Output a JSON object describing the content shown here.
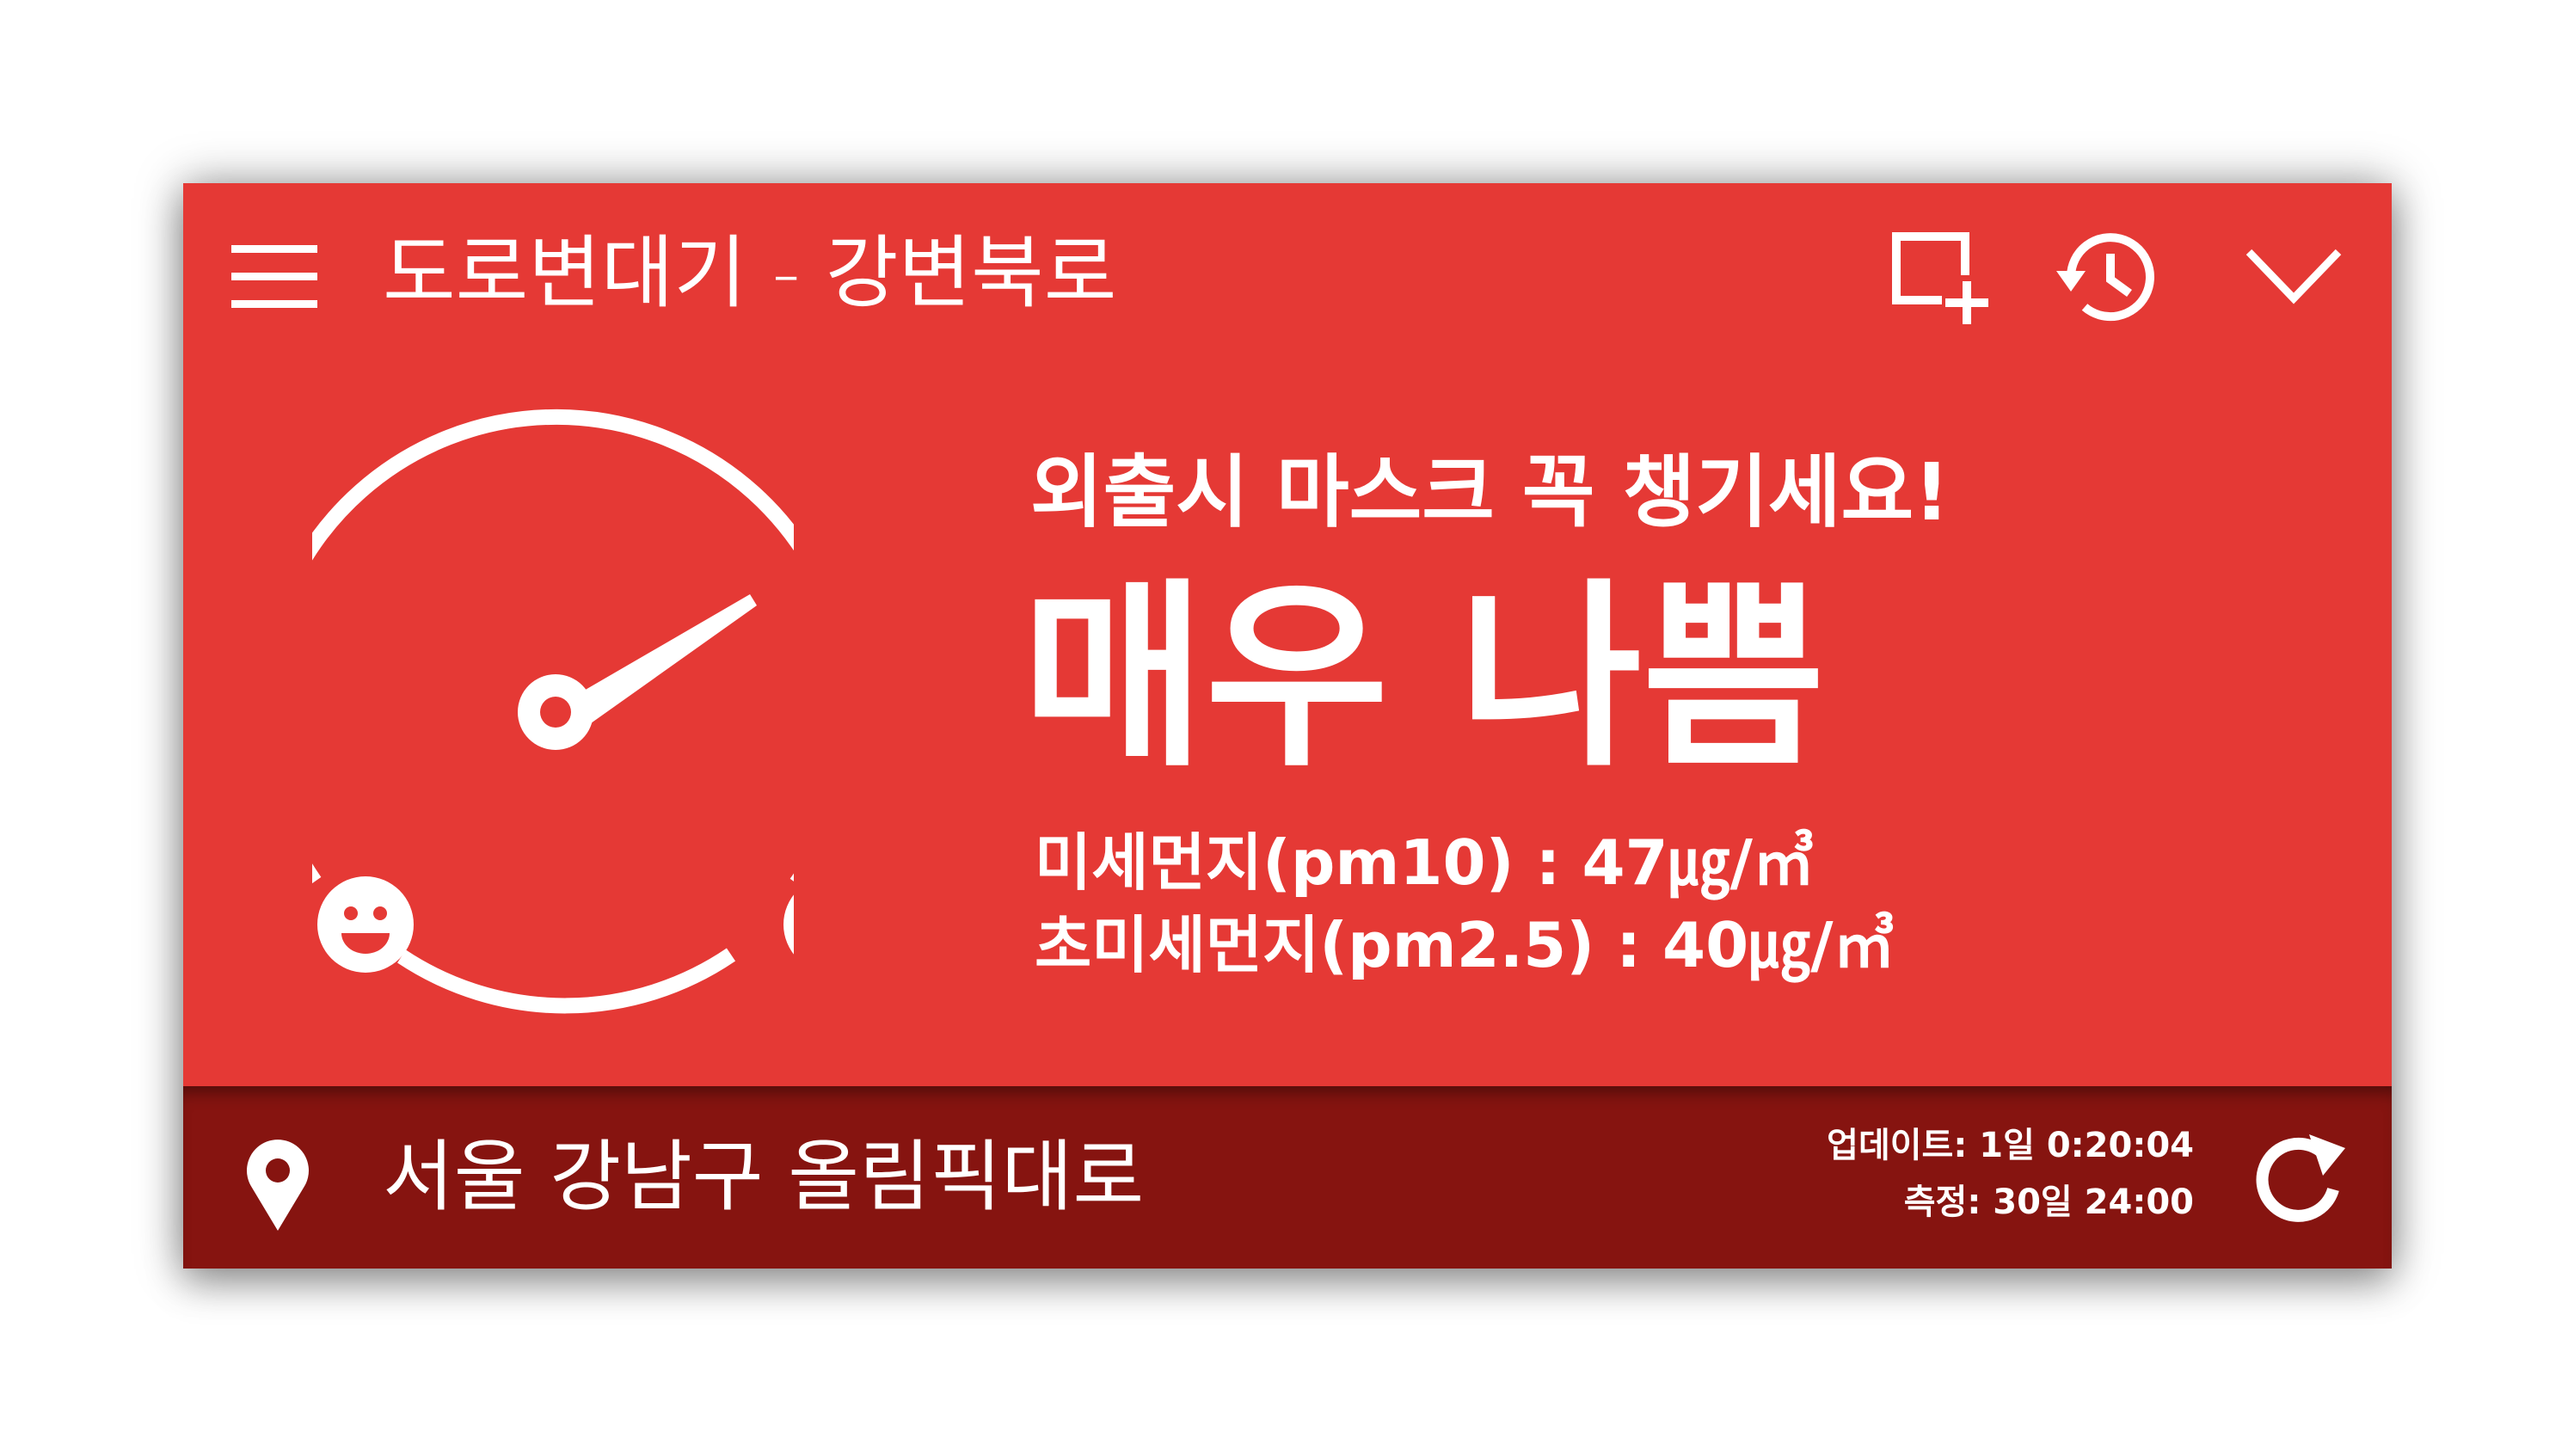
{
  "header": {
    "station_title": "도로변대기 - 강변북로",
    "icons": [
      "menu-icon",
      "add-widget-icon",
      "history-icon",
      "chevron-down-icon"
    ]
  },
  "status": {
    "advice": "외출시 마스크 꼭 챙기세요!",
    "grade": "매우 나쁨",
    "pm10_label": "미세먼지(pm10) : 47㎍/㎥",
    "pm25_label": "초미세먼지(pm2.5) : 40㎍/㎥",
    "gauge_level": 0.68,
    "gauge_icons": [
      "happy-face-icon",
      "dizzy-face-icon"
    ]
  },
  "footer": {
    "location": "서울 강남구 올림픽대로",
    "updated": "업데이트: 1일 0:20:04",
    "measured": "측정: 30일 24:00",
    "icons": [
      "location-pin-icon",
      "refresh-icon"
    ]
  },
  "colors": {
    "main_bg": "#e53935",
    "footer_bg": "#861410",
    "foreground": "#ffffff"
  }
}
